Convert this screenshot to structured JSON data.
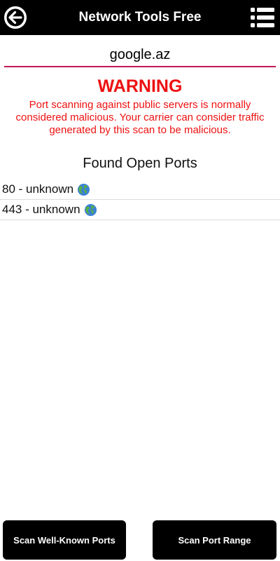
{
  "appbar": {
    "title": "Network Tools Free",
    "back_icon": "back-arrow-circle-icon",
    "menu_icon": "list-menu-icon"
  },
  "host": {
    "value": "google.az",
    "accent_color": "#c2185b"
  },
  "warning": {
    "title": "WARNING",
    "text": "Port scanning against public servers is normally considered malicious. Your carrier can consider traffic generated by this scan to be malicious.",
    "color": "#ee1111"
  },
  "ports": {
    "heading": "Found Open Ports",
    "items": [
      {
        "label": "80 - unknown",
        "icon": "globe-icon"
      },
      {
        "label": "443 - unknown",
        "icon": "globe-icon"
      }
    ]
  },
  "buttons": {
    "scan_well_known": "Scan Well-Known Ports",
    "scan_range": "Scan Port Range"
  }
}
